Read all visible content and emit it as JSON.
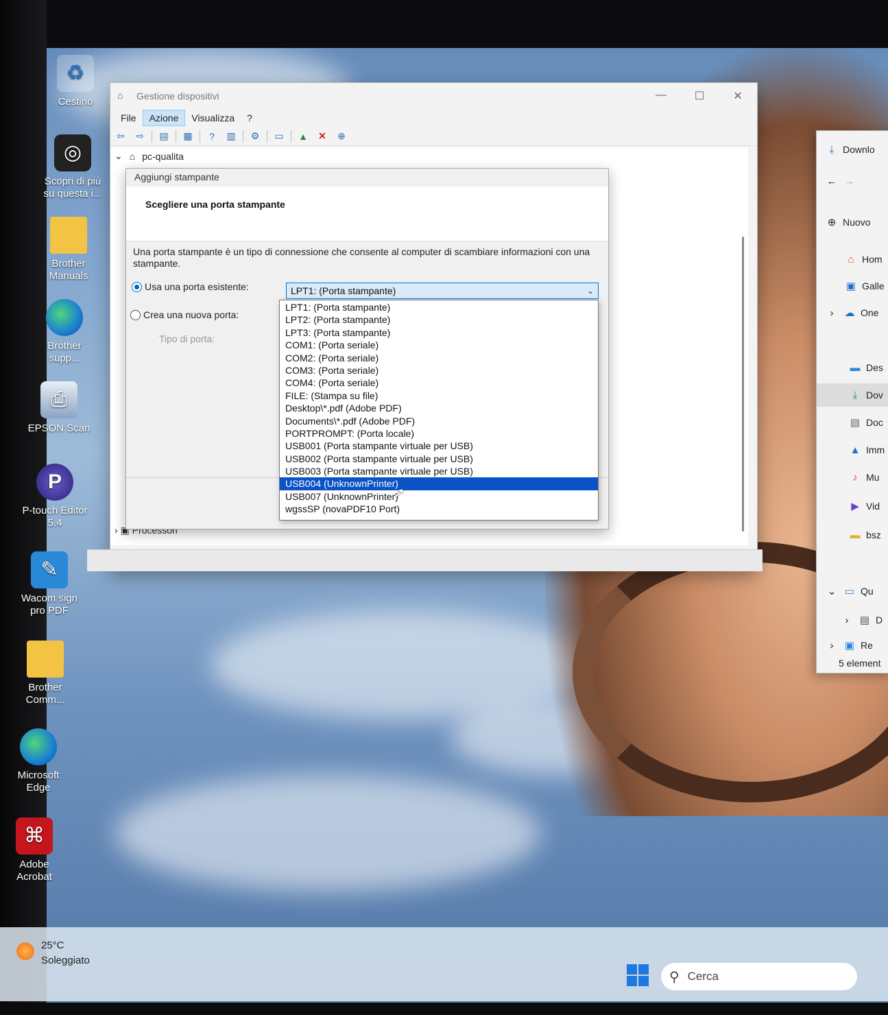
{
  "colors": {
    "selection": "#0a52c6",
    "accent": "#0067c0",
    "combo_bg": "#dbeaf8"
  },
  "desktop_icons": [
    {
      "label": "Cestino",
      "icon": "recycle-bin-icon"
    },
    {
      "label": "Scopri di più su questa i...",
      "icon": "discover-icon"
    },
    {
      "label": "Brother Manuals",
      "icon": "folder-icon"
    },
    {
      "label": "Brother supp...",
      "icon": "edge-icon"
    },
    {
      "label": "EPSON Scan",
      "icon": "scanner-icon"
    },
    {
      "label": "P-touch Editor 5.4",
      "icon": "ptouch-icon"
    },
    {
      "label": "Wacom sign pro PDF",
      "icon": "wacom-icon"
    },
    {
      "label": "Brother Comm...",
      "icon": "folder-icon"
    },
    {
      "label": "Microsoft Edge",
      "icon": "edge-icon"
    },
    {
      "label": "Adobe Acrobat",
      "icon": "acrobat-icon"
    }
  ],
  "device_manager": {
    "title": "Gestione dispositivi",
    "menu": [
      "File",
      "Azione",
      "Visualizza",
      "?"
    ],
    "tree_root": "pc-qualita",
    "tree_bottom": "Processori"
  },
  "dialog": {
    "title": "Aggiungi stampante",
    "heading": "Scegliere una porta stampante",
    "description": "Una porta stampante è un tipo di connessione che consente al computer di scambiare informazioni con una stampante.",
    "existing_port_label": "Usa una porta esistente:",
    "new_port_label": "Crea una nuova porta:",
    "port_type_label": "Tipo di porta:",
    "selected_port": "LPT1: (Porta stampante)",
    "port_options": [
      "LPT1: (Porta stampante)",
      "LPT2: (Porta stampante)",
      "LPT3: (Porta stampante)",
      "COM1: (Porta seriale)",
      "COM2: (Porta seriale)",
      "COM3: (Porta seriale)",
      "COM4: (Porta seriale)",
      "FILE: (Stampa su file)",
      "Desktop\\*.pdf (Adobe PDF)",
      "Documents\\*.pdf (Adobe PDF)",
      "PORTPROMPT: (Porta locale)",
      "USB001 (Porta stampante virtuale per USB)",
      "USB002 (Porta stampante virtuale per USB)",
      "USB003 (Porta stampante virtuale per USB)",
      "USB004 (UnknownPrinter)",
      "USB007 (UnknownPrinter)",
      "wgssSP (novaPDF10 Port)"
    ],
    "highlighted_option": "USB004 (UnknownPrinter)"
  },
  "explorer": {
    "items": [
      "Downlo",
      "Nuovo",
      "Hom",
      "Galle",
      "One",
      "Des",
      "Dov",
      "Doc",
      "Imm",
      "Mu",
      "Vid",
      "bsz",
      "Qu",
      "D",
      "Re"
    ],
    "status": "5 element"
  },
  "taskbar": {
    "temperature": "25°C",
    "condition": "Soleggiato",
    "search_placeholder": "Cerca"
  }
}
